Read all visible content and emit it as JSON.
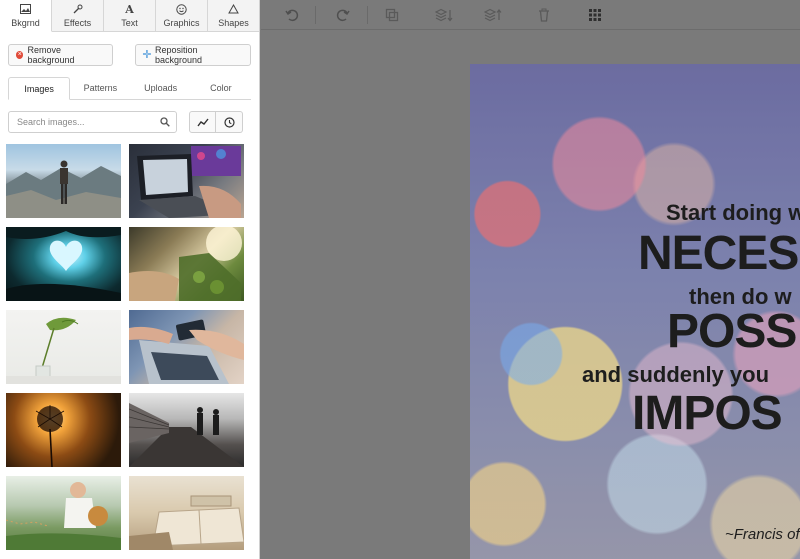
{
  "panel": {
    "tabs": [
      {
        "label": "Bkgrnd",
        "icon": "image-icon"
      },
      {
        "label": "Effects",
        "icon": "wand-icon"
      },
      {
        "label": "Text",
        "icon": "text-icon"
      },
      {
        "label": "Graphics",
        "icon": "smiley-icon"
      },
      {
        "label": "Shapes",
        "icon": "triangle-icon"
      }
    ],
    "remove_label": "Remove background",
    "reposition_label": "Reposition background",
    "subtabs": [
      "Images",
      "Patterns",
      "Uploads",
      "Color"
    ],
    "search": {
      "placeholder": "Search images..."
    }
  },
  "colors": {
    "remove_icon": "#e04b3a",
    "reposition_icon": "#3b8fd8",
    "workspace": "#7a7a7a"
  },
  "canvas": {
    "quote_lines": [
      "Start doing w",
      "NECES",
      "then do w",
      "POSS",
      "and suddenly you",
      "IMPOS",
      "~Francis of"
    ]
  }
}
